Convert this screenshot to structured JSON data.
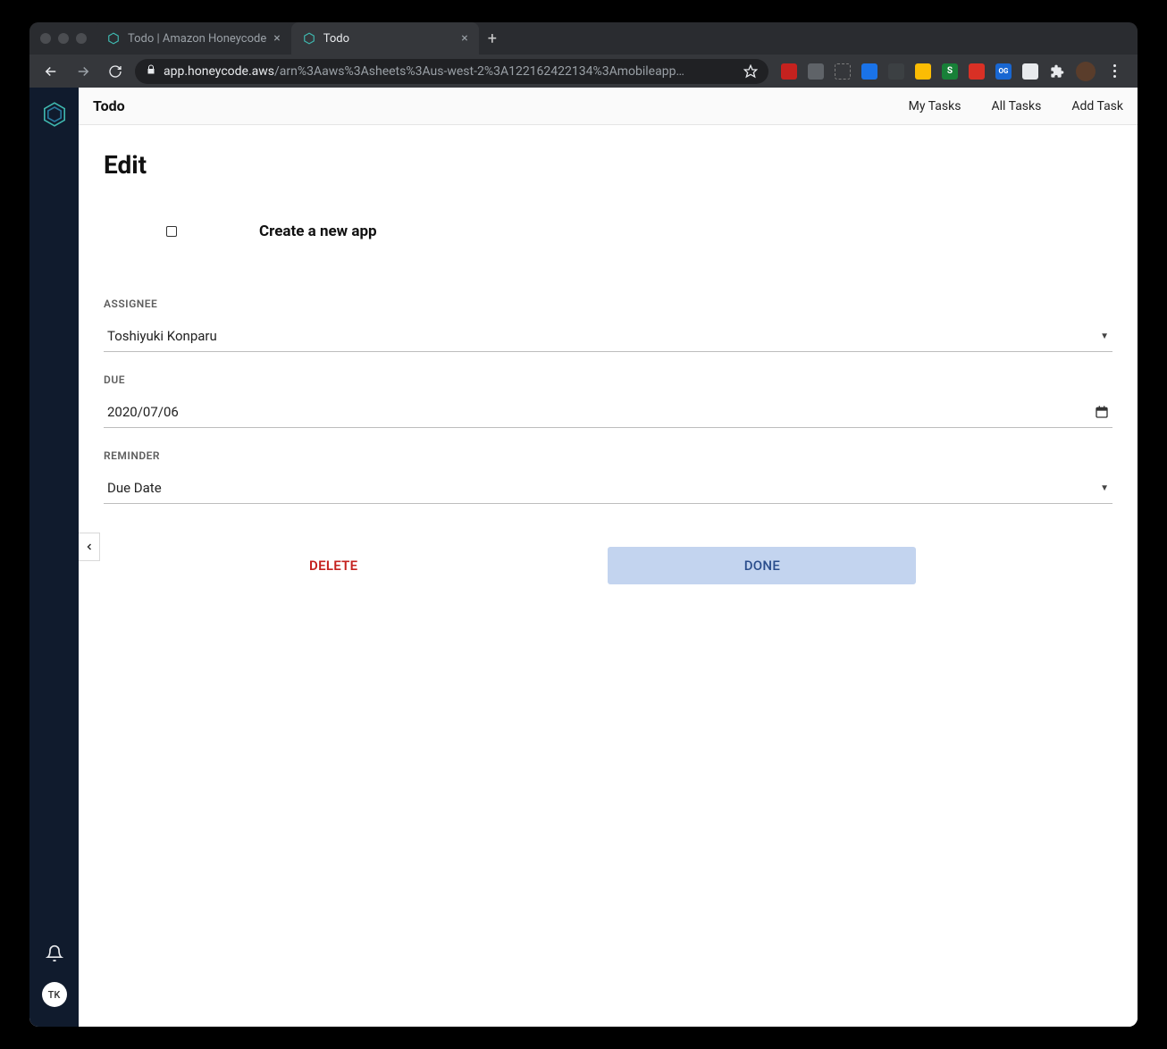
{
  "browser": {
    "tabs": [
      {
        "title": "Todo | Amazon Honeycode",
        "active": false
      },
      {
        "title": "Todo",
        "active": true
      }
    ],
    "url_host": "app.honeycode.aws",
    "url_path": "/arn%3Aaws%3Asheets%3Aus-west-2%3A122162422134%3Amobileapp…"
  },
  "sidebar": {
    "user_initials": "TK"
  },
  "app_header": {
    "title": "Todo",
    "nav": {
      "my_tasks": "My Tasks",
      "all_tasks": "All Tasks",
      "add_task": "Add Task"
    }
  },
  "page": {
    "title": "Edit",
    "task_name": "Create a new app",
    "fields": {
      "assignee": {
        "label": "ASSIGNEE",
        "value": "Toshiyuki Konparu"
      },
      "due": {
        "label": "DUE",
        "value": "2020/07/06"
      },
      "reminder": {
        "label": "REMINDER",
        "value": "Due Date"
      }
    },
    "actions": {
      "delete": "DELETE",
      "done": "DONE"
    }
  }
}
